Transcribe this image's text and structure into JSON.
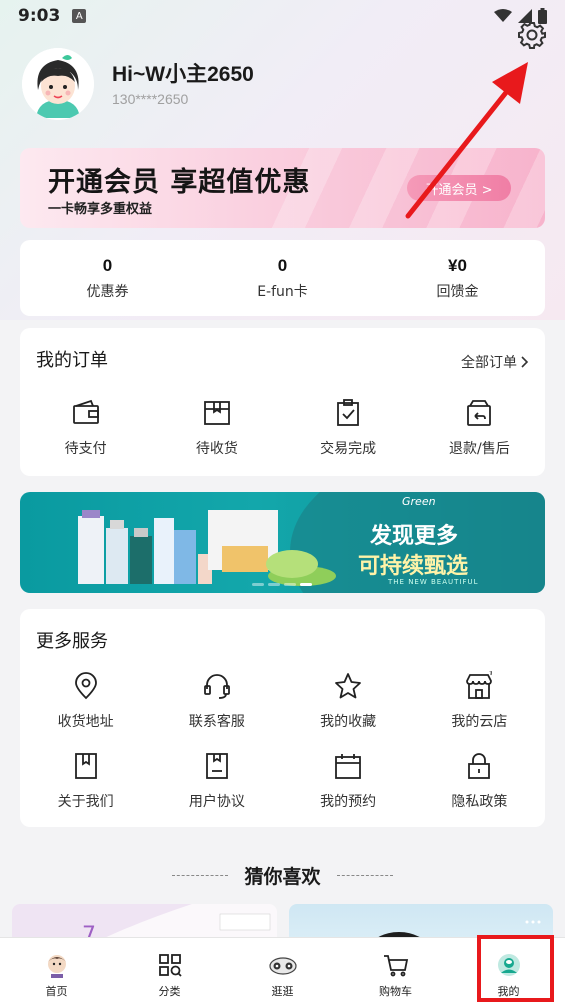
{
  "status": {
    "time": "9:03",
    "a_badge": "A"
  },
  "profile": {
    "username": "Hi~W小主2650",
    "phone": "130****2650"
  },
  "member_banner": {
    "title": "开通会员 享超值优惠",
    "subtitle": "一卡畅享多重权益",
    "button": "开通会员 >"
  },
  "stats": [
    {
      "value": "0",
      "label": "优惠券"
    },
    {
      "value": "0",
      "label": "E-fun卡"
    },
    {
      "value": "¥0",
      "label": "回馈金"
    }
  ],
  "orders": {
    "title": "我的订单",
    "all_label": "全部订单",
    "items": [
      {
        "label": "待支付",
        "icon": "wallet-icon"
      },
      {
        "label": "待收货",
        "icon": "package-icon"
      },
      {
        "label": "交易完成",
        "icon": "clipboard-check-icon"
      },
      {
        "label": "退款/售后",
        "icon": "return-box-icon"
      }
    ]
  },
  "ad_banner": {
    "logo": "Green",
    "line1": "发现更多",
    "line2": "可持续甄选",
    "tag": "THE NEW BEAUTIFUL"
  },
  "services": {
    "title": "更多服务",
    "row1": [
      {
        "label": "收货地址",
        "icon": "location-icon"
      },
      {
        "label": "联系客服",
        "icon": "headset-icon"
      },
      {
        "label": "我的收藏",
        "icon": "star-icon"
      },
      {
        "label": "我的云店",
        "icon": "store-icon"
      }
    ],
    "row2": [
      {
        "label": "关于我们",
        "icon": "bookmark-icon"
      },
      {
        "label": "用户协议",
        "icon": "document-icon"
      },
      {
        "label": "我的预约",
        "icon": "calendar-icon"
      },
      {
        "label": "隐私政策",
        "icon": "lock-icon"
      }
    ]
  },
  "guess": {
    "title": "猜你喜欢"
  },
  "tabbar": [
    {
      "label": "首页",
      "icon": "home-mascot-icon"
    },
    {
      "label": "分类",
      "icon": "category-grid-icon"
    },
    {
      "label": "逛逛",
      "icon": "explore-icon"
    },
    {
      "label": "购物车",
      "icon": "cart-icon"
    },
    {
      "label": "我的",
      "icon": "profile-icon"
    }
  ],
  "colors": {
    "annotation_red": "#e8191c",
    "member_pink": "#f07ea5",
    "teal": "#13a7ab"
  }
}
